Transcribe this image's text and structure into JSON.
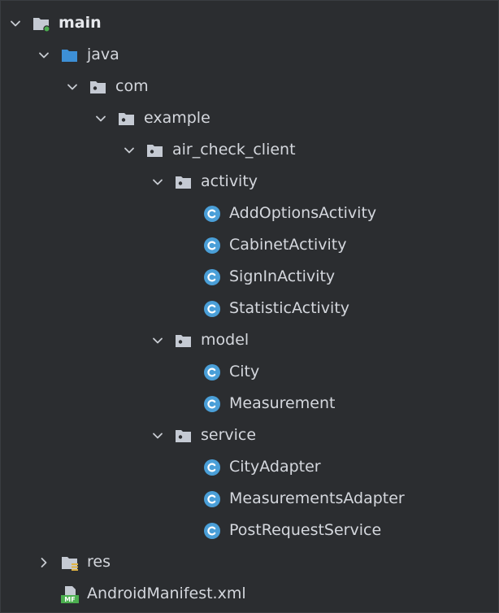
{
  "tree": [
    {
      "id": "main",
      "label": "main",
      "depth": 0,
      "expanded": true,
      "icon": "module-folder-icon",
      "bold": true
    },
    {
      "id": "java",
      "label": "java",
      "depth": 1,
      "expanded": true,
      "icon": "source-folder-icon"
    },
    {
      "id": "com",
      "label": "com",
      "depth": 2,
      "expanded": true,
      "icon": "package-icon"
    },
    {
      "id": "example",
      "label": "example",
      "depth": 3,
      "expanded": true,
      "icon": "package-icon"
    },
    {
      "id": "air_check_client",
      "label": "air_check_client",
      "depth": 4,
      "expanded": true,
      "icon": "package-icon"
    },
    {
      "id": "activity",
      "label": "activity",
      "depth": 5,
      "expanded": true,
      "icon": "package-icon"
    },
    {
      "id": "AddOptionsActivity",
      "label": "AddOptionsActivity",
      "depth": 6,
      "icon": "class-icon"
    },
    {
      "id": "CabinetActivity",
      "label": "CabinetActivity",
      "depth": 6,
      "icon": "class-icon"
    },
    {
      "id": "SignInActivity",
      "label": "SignInActivity",
      "depth": 6,
      "icon": "class-icon"
    },
    {
      "id": "StatisticActivity",
      "label": "StatisticActivity",
      "depth": 6,
      "icon": "class-icon"
    },
    {
      "id": "model",
      "label": "model",
      "depth": 5,
      "expanded": true,
      "icon": "package-icon"
    },
    {
      "id": "City",
      "label": "City",
      "depth": 6,
      "icon": "class-icon"
    },
    {
      "id": "Measurement",
      "label": "Measurement",
      "depth": 6,
      "icon": "class-icon"
    },
    {
      "id": "service",
      "label": "service",
      "depth": 5,
      "expanded": true,
      "icon": "package-icon"
    },
    {
      "id": "CityAdapter",
      "label": "CityAdapter",
      "depth": 6,
      "icon": "class-icon"
    },
    {
      "id": "MeasurementsAdapter",
      "label": "MeasurementsAdapter",
      "depth": 6,
      "icon": "class-icon"
    },
    {
      "id": "PostRequestService",
      "label": "PostRequestService",
      "depth": 6,
      "icon": "class-icon"
    },
    {
      "id": "res",
      "label": "res",
      "depth": 1,
      "expanded": false,
      "icon": "resource-folder-icon"
    },
    {
      "id": "AndroidManifest.xml",
      "label": "AndroidManifest.xml",
      "depth": 1,
      "icon": "manifest-file-icon",
      "badge": "MF"
    }
  ],
  "colors": {
    "background": "#2b2d30",
    "text": "#d4d7dd",
    "folder": "#c5cad3",
    "source_folder": "#3d8fd6",
    "class_icon": "#4a9fd8",
    "module_dot": "#4caf50",
    "manifest": "#4caf50"
  }
}
